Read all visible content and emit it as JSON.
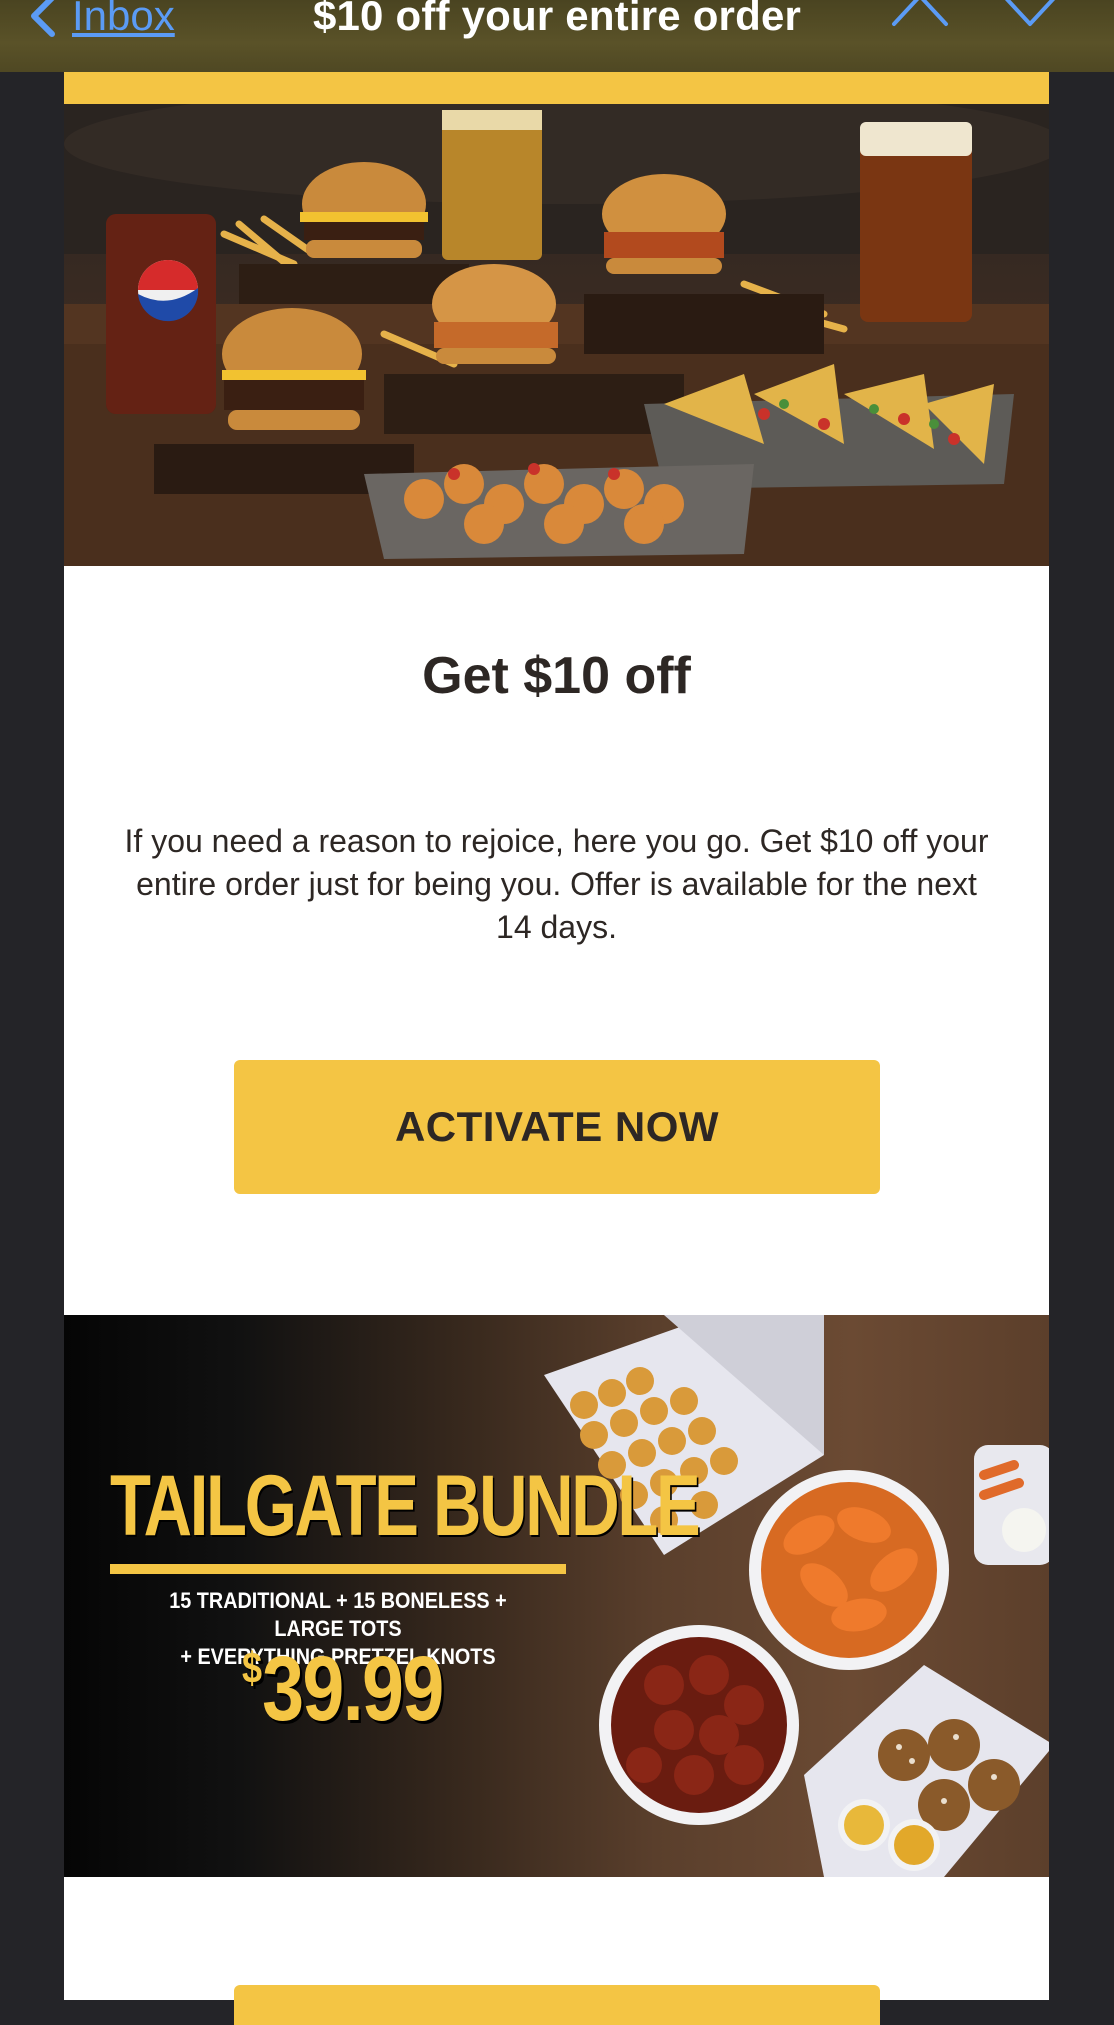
{
  "nav": {
    "back_label": "Inbox",
    "title": "$10 off your entire order"
  },
  "email": {
    "heading": "Get $10 off",
    "body": "If you need a reason to rejoice, here you go. Get $10 off your entire order just for being you. Offer is available for the next 14 days.",
    "cta_label": "ACTIVATE NOW",
    "promo": {
      "title": "TAILGATE BUNDLE",
      "subtitle_line1": "15 TRADITIONAL + 15 BONELESS + LARGE TOTS",
      "subtitle_line2": "+ EVERYTHING PRETZEL KNOTS",
      "price_currency": "$",
      "price_amount": "39.99"
    }
  },
  "colors": {
    "accent": "#f4c544",
    "link": "#5b9bf5",
    "text": "#2d2724",
    "background": "#242428"
  },
  "icons": {
    "back": "chevron-left-icon",
    "prev_message": "chevron-up-icon",
    "next_message": "chevron-down-icon"
  }
}
